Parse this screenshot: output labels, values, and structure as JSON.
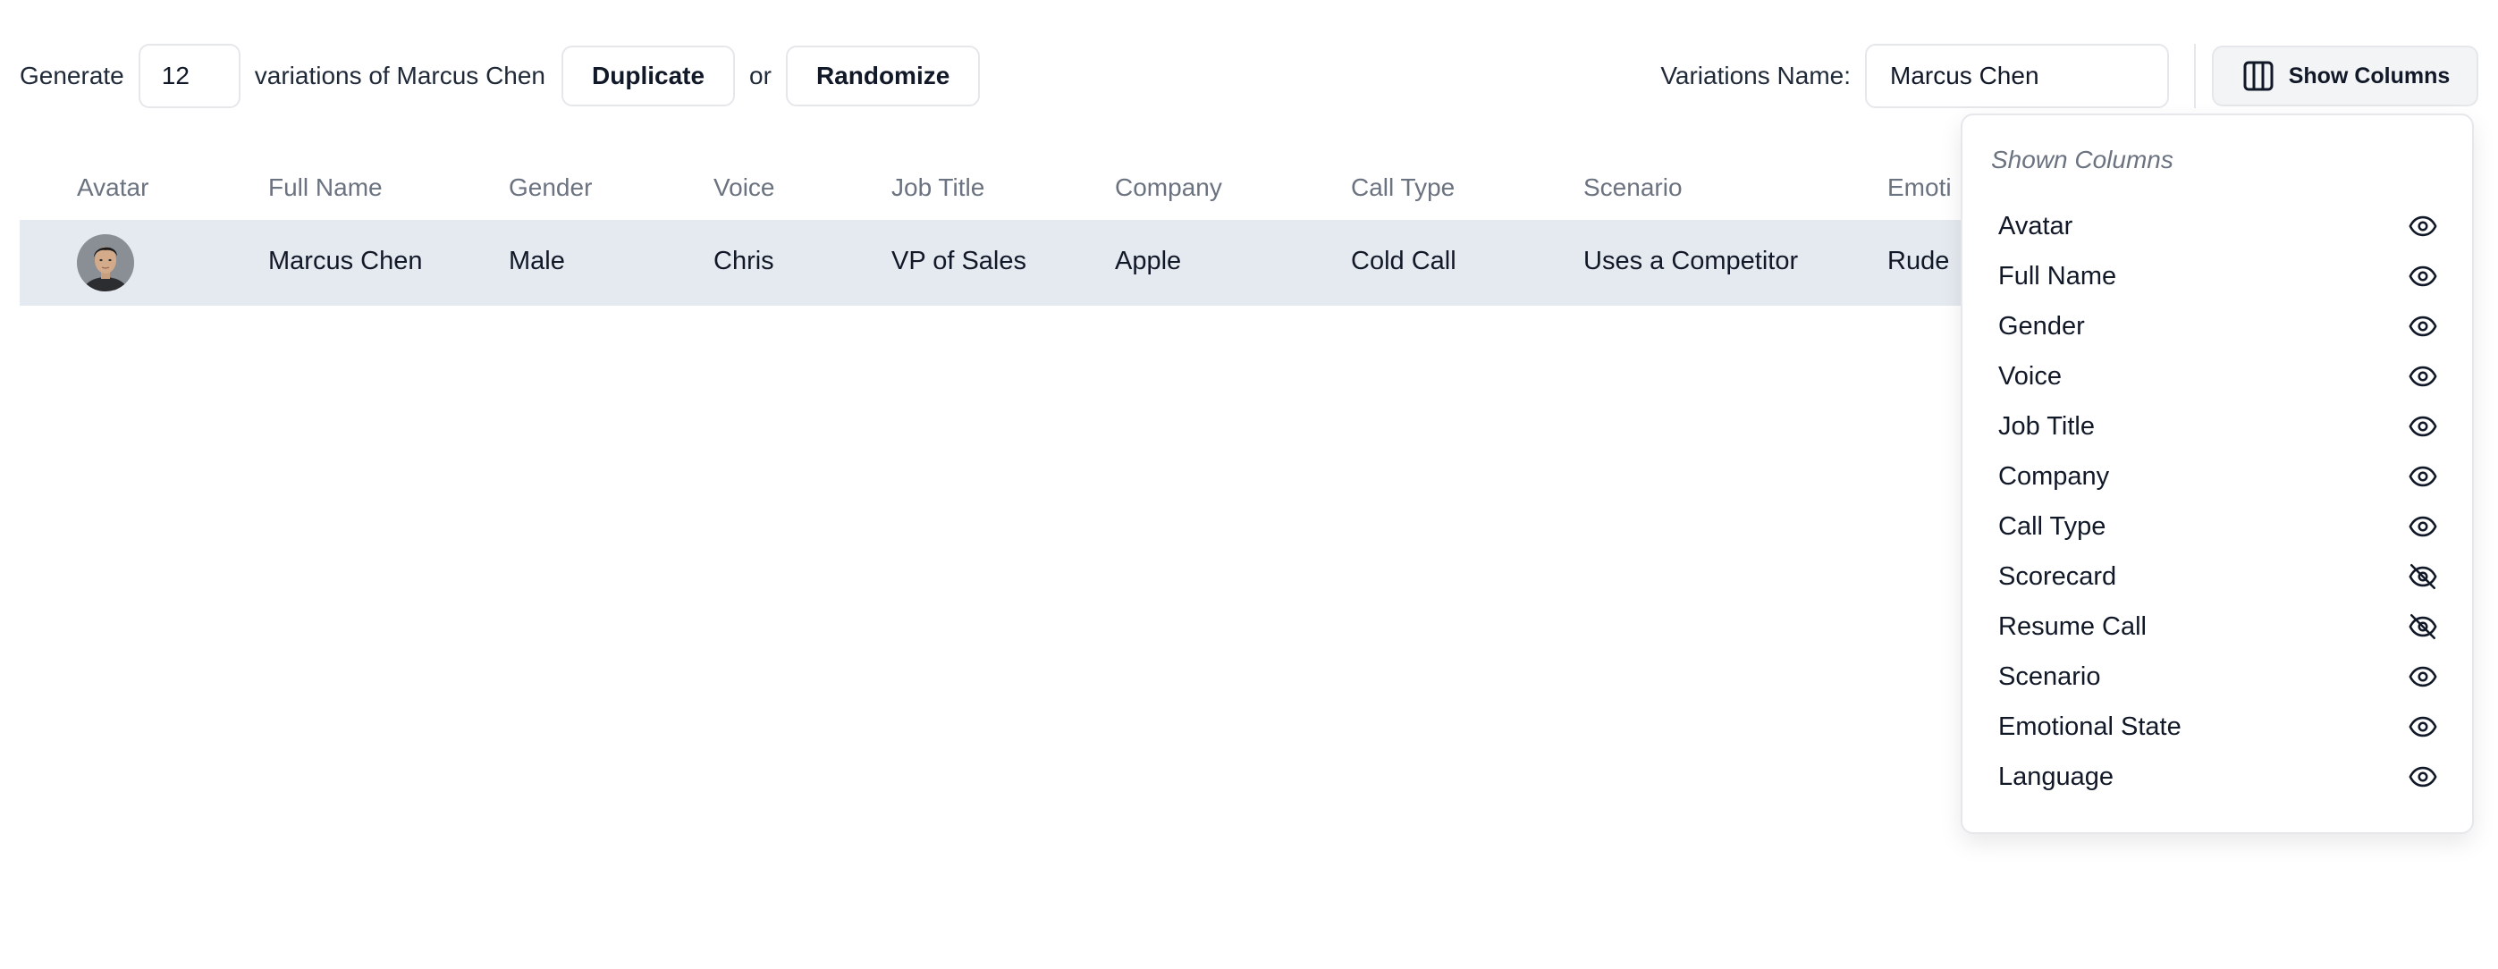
{
  "toolbar": {
    "generate_label": "Generate",
    "count_value": "12",
    "variations_of_label": "variations of Marcus Chen",
    "duplicate_label": "Duplicate",
    "or_label": "or",
    "randomize_label": "Randomize",
    "variations_name_label": "Variations Name:",
    "variations_name_value": "Marcus Chen",
    "show_columns_label": "Show Columns",
    "show_columns_icon": "columns-icon"
  },
  "table": {
    "columns": [
      "Avatar",
      "Full Name",
      "Gender",
      "Voice",
      "Job Title",
      "Company",
      "Call Type",
      "Scenario",
      "Emoti"
    ],
    "rows": [
      {
        "avatar": "avatar-photo",
        "cells": [
          "Marcus Chen",
          "Male",
          "Chris",
          "VP of Sales",
          "Apple",
          "Cold Call",
          "Uses a Competitor",
          "Rude"
        ]
      }
    ]
  },
  "columns_panel": {
    "title": "Shown Columns",
    "options": [
      {
        "label": "Avatar",
        "visible": true,
        "icon": "eye-icon"
      },
      {
        "label": "Full Name",
        "visible": true,
        "icon": "eye-icon"
      },
      {
        "label": "Gender",
        "visible": true,
        "icon": "eye-icon"
      },
      {
        "label": "Voice",
        "visible": true,
        "icon": "eye-icon"
      },
      {
        "label": "Job Title",
        "visible": true,
        "icon": "eye-icon"
      },
      {
        "label": "Company",
        "visible": true,
        "icon": "eye-icon"
      },
      {
        "label": "Call Type",
        "visible": true,
        "icon": "eye-icon"
      },
      {
        "label": "Scorecard",
        "visible": false,
        "icon": "eye-off-icon"
      },
      {
        "label": "Resume Call",
        "visible": false,
        "icon": "eye-off-icon"
      },
      {
        "label": "Scenario",
        "visible": true,
        "icon": "eye-icon"
      },
      {
        "label": "Emotional State",
        "visible": true,
        "icon": "eye-icon"
      },
      {
        "label": "Language",
        "visible": true,
        "icon": "eye-icon"
      }
    ]
  }
}
